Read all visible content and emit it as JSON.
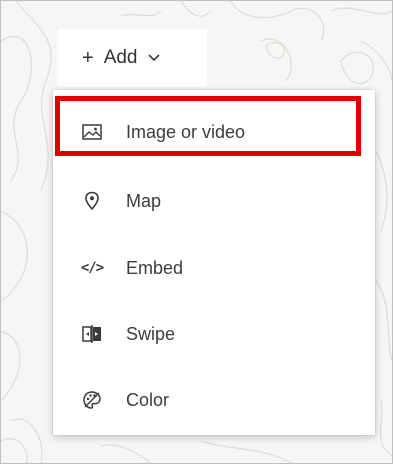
{
  "add_button": {
    "plus": "+",
    "label": "Add"
  },
  "menu": {
    "items": [
      {
        "label": "Image or video",
        "icon": "image-icon",
        "highlighted": true
      },
      {
        "label": "Map",
        "icon": "map-pin-icon"
      },
      {
        "label": "Embed",
        "icon": "code-icon",
        "glyph": "</>"
      },
      {
        "label": "Swipe",
        "icon": "swipe-icon"
      },
      {
        "label": "Color",
        "icon": "palette-icon"
      }
    ]
  },
  "colors": {
    "highlight_border": "#e00000",
    "menu_background": "#ffffff",
    "text": "#3c3c3c",
    "backdrop": "#f6f6f4"
  }
}
